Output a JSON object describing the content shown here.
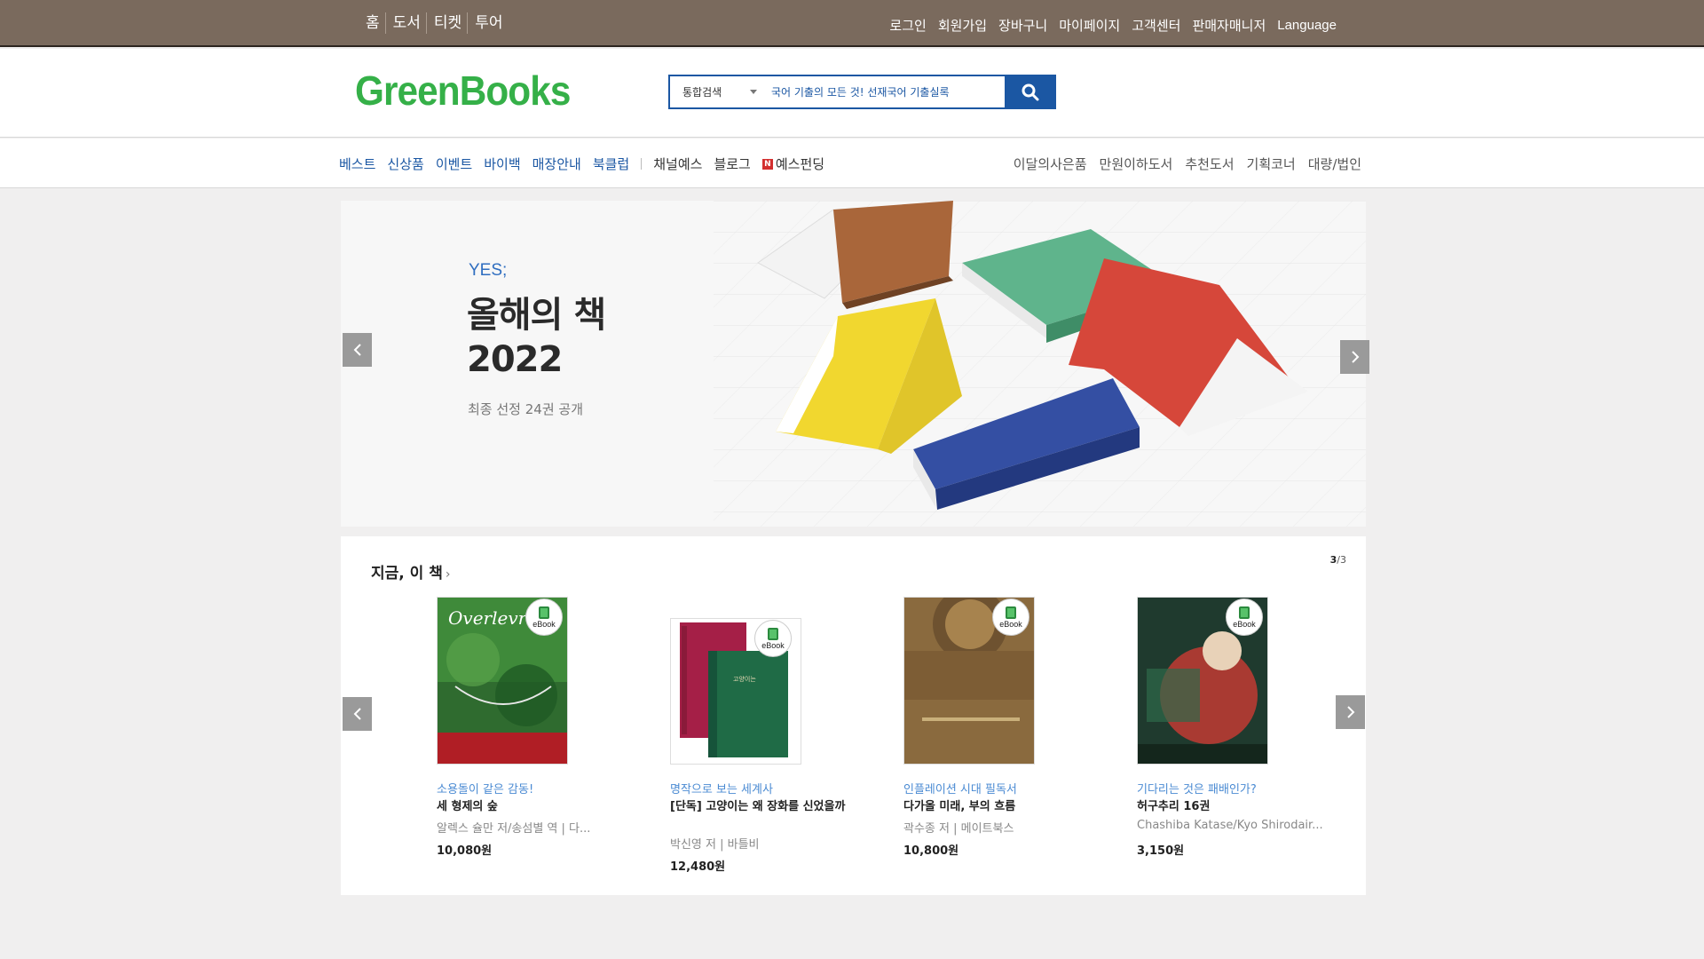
{
  "topbar": {
    "left_links": [
      "홈",
      "도서",
      "티켓",
      "투어"
    ],
    "right_links": [
      "로그인",
      "회원가입",
      "장바구니",
      "마이페이지",
      "고객센터",
      "판매자매니저"
    ],
    "language": "Language"
  },
  "header": {
    "logo": "GreenBooks",
    "search_category": "통합검색",
    "search_value": "국어 기출의 모든 것! 선재국어 기출실록"
  },
  "nav": {
    "primary": [
      "베스트",
      "신상품",
      "이벤트",
      "바이백",
      "매장안내",
      "북클럽"
    ],
    "secondary": [
      "채널예스",
      "블로그"
    ],
    "yfunding": "예스펀딩",
    "right": [
      "이달의사은품",
      "만원이하도서",
      "추천도서",
      "기획코너",
      "대량/법인"
    ]
  },
  "banner": {
    "brand": "YES;",
    "title_line1": "올해의 책",
    "title_line2": "2022",
    "subtitle": "최종 선정 24권 공개"
  },
  "books_section": {
    "title": "지금, 이 책",
    "pager_current": "3",
    "pager_total": "3",
    "items": [
      {
        "tag": "소용돌이 같은 감동!",
        "title": "세 형제의 숲",
        "author": "알렉스 슐만 저/송섬별 역 | 다...",
        "price": "10,080원",
        "ebook": "eBook"
      },
      {
        "tag": "명작으로 보는 세계사",
        "title": "[단독] 고양이는 왜 장화를 신었을까",
        "author": "박신영 저 | 바틀비",
        "price": "12,480원",
        "ebook": "eBook"
      },
      {
        "tag": "인플레이션 시대 필독서",
        "title": "다가올 미래, 부의 흐름",
        "author": "곽수종 저 | 메이트북스",
        "price": "10,800원",
        "ebook": "eBook"
      },
      {
        "tag": "기다리는 것은 패배인가?",
        "title": "허구추리 16권",
        "author": "Chashiba Katase/Kyo Shirodair...",
        "price": "3,150원",
        "ebook": "eBook"
      }
    ]
  },
  "colors": {
    "topbar": "#7a6a5d",
    "logo": "#35b048",
    "search_border": "#1b57a3",
    "nav_link": "#1b57a3"
  }
}
